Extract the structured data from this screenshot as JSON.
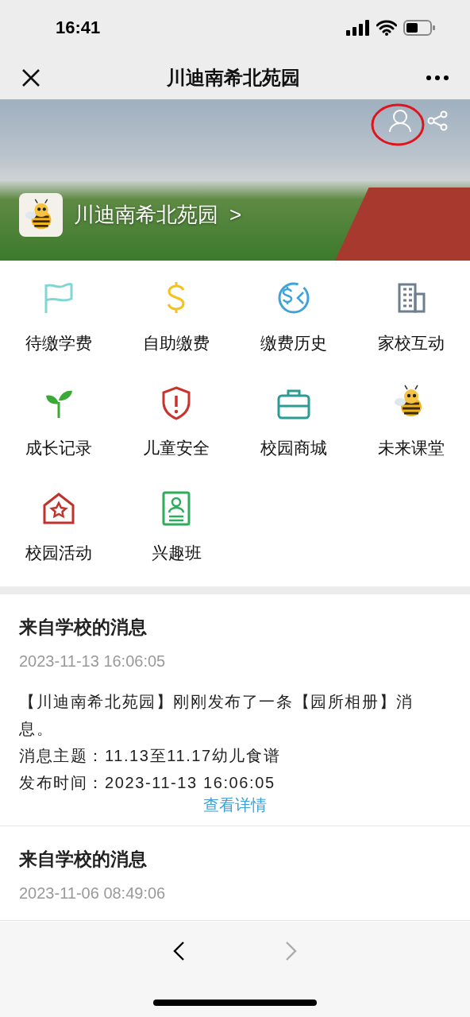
{
  "status_bar": {
    "time": "16:41"
  },
  "nav_bar": {
    "title": "川迪南希北苑园"
  },
  "banner": {
    "school_name": "川迪南希北苑园",
    "chevron": ">"
  },
  "menu_items": [
    {
      "label": "待缴学费"
    },
    {
      "label": "自助缴费"
    },
    {
      "label": "缴费历史"
    },
    {
      "label": "家校互动"
    },
    {
      "label": "成长记录"
    },
    {
      "label": "儿童安全"
    },
    {
      "label": "校园商城"
    },
    {
      "label": "未来课堂"
    },
    {
      "label": "校园活动"
    },
    {
      "label": "兴趣班"
    }
  ],
  "messages": [
    {
      "title": "来自学校的消息",
      "time": "2023-11-13 16:06:05",
      "body": "【川迪南希北苑园】刚刚发布了一条【园所相册】消息。",
      "topic": "消息主题：11.13至11.17幼儿食谱",
      "published": "发布时间：2023-11-13 16:06:05",
      "link": "查看详情"
    },
    {
      "title": "来自学校的消息",
      "time": "2023-11-06 08:49:06"
    }
  ],
  "toolbar": {
    "back": {
      "disabled": false
    },
    "forward": {
      "disabled": true
    }
  }
}
